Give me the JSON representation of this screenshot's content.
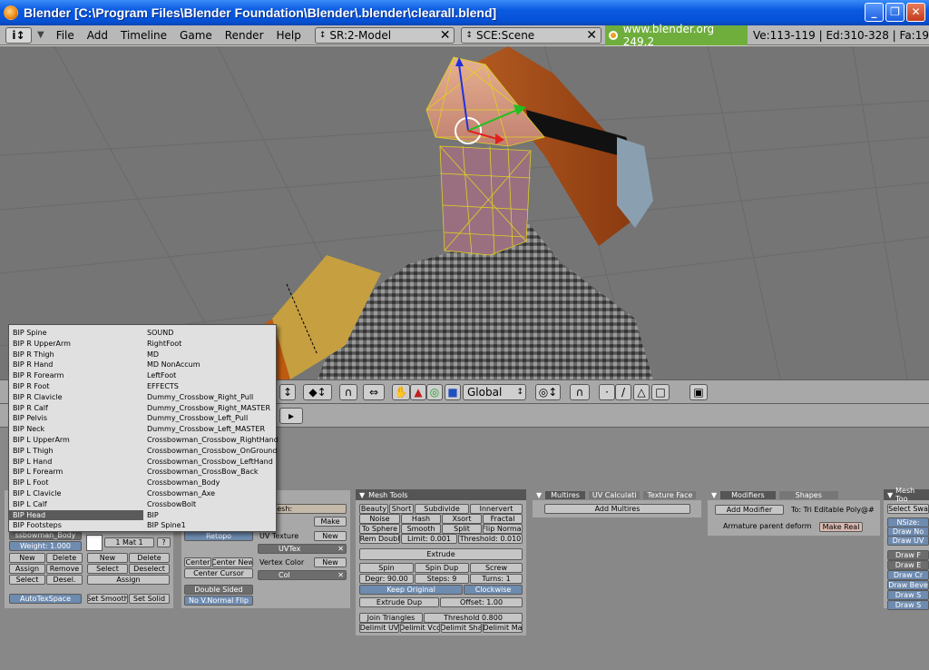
{
  "window": {
    "title": "Blender [C:\\Program Files\\Blender Foundation\\Blender\\.blender\\clearall.blend]",
    "controls": [
      "_",
      "❐",
      "✕"
    ]
  },
  "header": {
    "menus": [
      "File",
      "Add",
      "Timeline",
      "Game",
      "Render",
      "Help"
    ],
    "screen": "SR:2-Model",
    "scene": "SCE:Scene",
    "url": "www.blender.org 249.2",
    "stats": "Ve:113-119 | Ed:310-328 | Fa:19"
  },
  "viewheader": {
    "orientation": "Global"
  },
  "popup": {
    "left": [
      "BIP Spine",
      "BIP R UpperArm",
      "BIP R Thigh",
      "BIP R Hand",
      "BIP R Forearm",
      "BIP R Foot",
      "BIP R Clavicle",
      "BIP R Calf",
      "BIP Pelvis",
      "BIP Neck",
      "BIP L UpperArm",
      "BIP L Thigh",
      "BIP L Hand",
      "BIP L Forearm",
      "BIP L Foot",
      "BIP L Clavicle",
      "BIP L Calf",
      "BIP Head",
      "BIP Footsteps"
    ],
    "right": [
      "SOUND",
      "RightFoot",
      "MD",
      "MD NonAccum",
      "LeftFoot",
      "EFFECTS",
      "Dummy_Crossbow_Right_Pull",
      "Dummy_Crossbow_Right_MASTER",
      "Dummy_Crossbow_Left_Pull",
      "Dummy_Crossbow_Left_MASTER",
      "Crossbowman_Crossbow_RightHand",
      "Crossbowman_Crossbow_OnGround",
      "Crossbowman_Crossbow_LeftHand",
      "Crossbowman_CrossBow_Back",
      "Crossbowman_Body",
      "Crossbowman_Axe",
      "CrossbowBolt",
      "BIP",
      "BIP Spine1"
    ],
    "selected": "BIP Head"
  },
  "link_panel": {
    "group_name": "ssbowman_Body",
    "weight": "Weight: 1.000",
    "mat": "1 Mat 1",
    "question": "?",
    "new": "New",
    "delete": "Delete",
    "assign": "Assign",
    "remove": "Remove",
    "select": "Select",
    "deselect": "Desel.",
    "new2": "New",
    "delete2": "Delete",
    "select2": "Select",
    "deselect2": "Deselect",
    "assign2": "Assign",
    "autotex": "AutoTexSpace",
    "set_smooth": "Set Smooth",
    "set_solid": "Set Solid"
  },
  "mesh_panel": {
    "mesh_label": "lesh:",
    "make": "Make",
    "retopo": "Retopo",
    "uv_texture": "UV Texture",
    "new_uv": "New",
    "uvtex": "UVTex",
    "center_new": "Center New",
    "center": "Center",
    "center_cursor": "Center Cursor",
    "vertex_color": "Vertex Color",
    "new_vc": "New",
    "col": "Col",
    "double_sided": "Double Sided",
    "no_vnormal_flip": "No V.Normal Flip"
  },
  "mesh_tools": {
    "title": "Mesh Tools",
    "beauty": "Beauty",
    "short": "Short",
    "subdivide": "Subdivide",
    "innervert": "Innervert",
    "noise": "Noise",
    "hash": "Hash",
    "xsort": "Xsort",
    "fractal": "Fractal",
    "to_sphere": "To Sphere",
    "smooth": "Smooth",
    "split": "Split",
    "flip_normal": "Flip Normal",
    "rem_doubles": "Rem Doubl",
    "limit": "Limit: 0.001",
    "threshold": "Threshold: 0.010",
    "extrude": "Extrude",
    "spin": "Spin",
    "spin_dup": "Spin Dup",
    "screw": "Screw",
    "degr": "Degr: 90.00",
    "steps": "Steps: 9",
    "turns": "Turns: 1",
    "keep_original": "Keep Original",
    "clockwise": "Clockwise",
    "extrude_dup": "Extrude Dup",
    "offset": "Offset: 1.00",
    "join_triangles": "Join Triangles",
    "threshold2": "Threshold 0.800",
    "delimit_uv": "Delimit UV",
    "delimit_vco": "Delimit Vco",
    "delimit_sha": "Delimit Sha",
    "delimit_ma": "Delimit Ma"
  },
  "multires": {
    "tab1": "Multires",
    "tab2": "UV Calculati",
    "tab3": "Texture Face",
    "add": "Add Multires"
  },
  "modifiers": {
    "tab1": "Modifiers",
    "tab2": "Shapes",
    "add": "Add Modifier",
    "target": "To: Tri Editable Poly@#",
    "armature": "Armature parent deform",
    "make_real": "Make Real"
  },
  "mesh_tools_more": {
    "title": "Mesh Too",
    "select_swap": "Select Swa",
    "nsize": "NSize:",
    "draw1": "Draw No",
    "draw2": "Draw UV",
    "draw_f": "Draw F",
    "draw_e": "Draw E",
    "draw_c": "Draw Cr",
    "draw_b": "Draw Beve",
    "draw_s1": "Draw S",
    "draw_s2": "Draw S"
  }
}
